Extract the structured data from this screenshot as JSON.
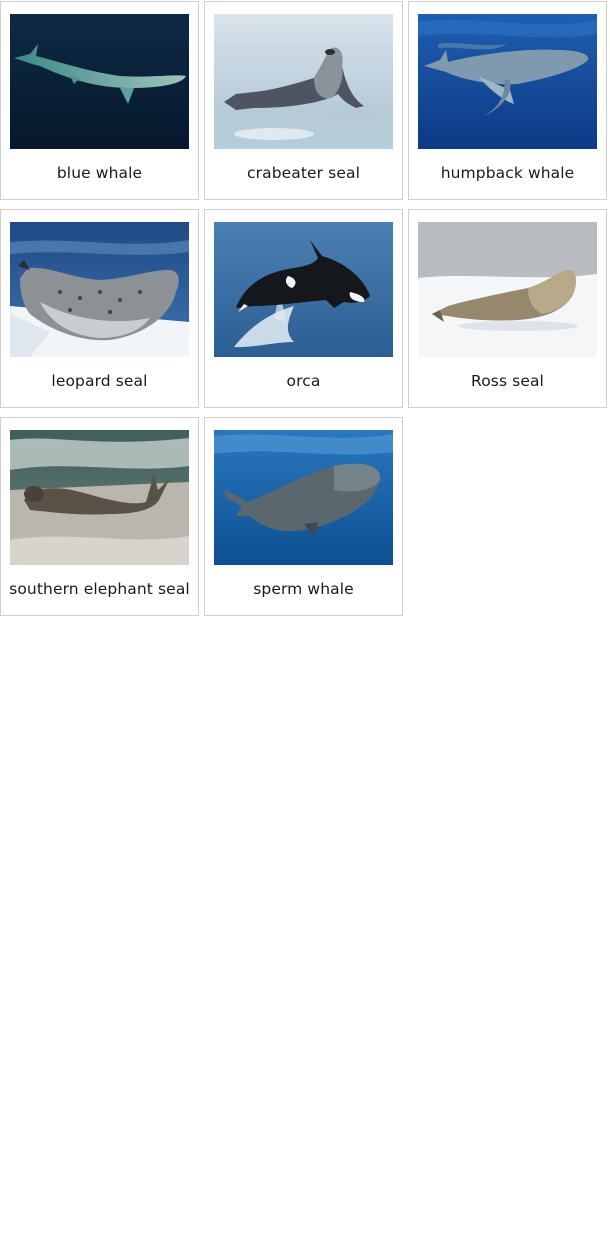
{
  "cards": [
    {
      "name": "blue whale",
      "image": "blue-whale-photo"
    },
    {
      "name": "crabeater seal",
      "image": "crabeater-seal-photo"
    },
    {
      "name": "humpback whale",
      "image": "humpback-whale-photo"
    },
    {
      "name": "leopard seal",
      "image": "leopard-seal-photo"
    },
    {
      "name": "orca",
      "image": "orca-photo"
    },
    {
      "name": "Ross seal",
      "image": "ross-seal-photo"
    },
    {
      "name": "southern elephant seal",
      "image": "southern-elephant-seal-photo"
    },
    {
      "name": "sperm whale",
      "image": "sperm-whale-photo"
    }
  ]
}
